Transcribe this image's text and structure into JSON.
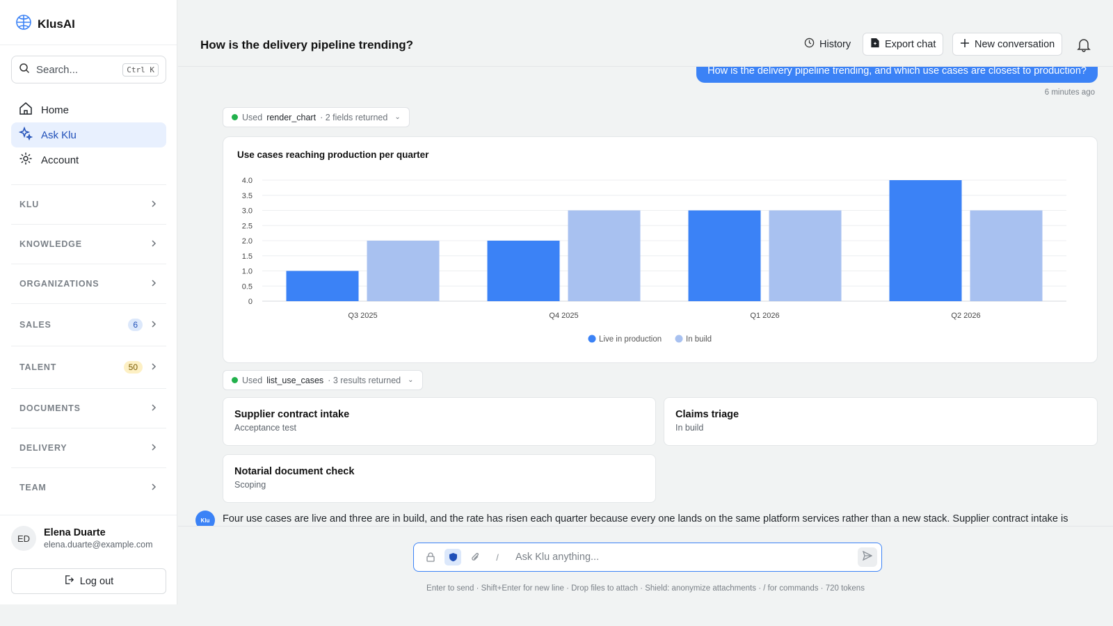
{
  "app": {
    "name": "KlusAI"
  },
  "search": {
    "placeholder": "Search...",
    "shortcut": "Ctrl K"
  },
  "nav": [
    {
      "label": "Home",
      "icon": "home-icon"
    },
    {
      "label": "Ask Klu",
      "icon": "sparkles-icon",
      "active": true
    },
    {
      "label": "Account",
      "icon": "gear-icon"
    }
  ],
  "sections": [
    {
      "label": "KLU"
    },
    {
      "label": "KNOWLEDGE"
    },
    {
      "label": "ORGANIZATIONS"
    },
    {
      "label": "SALES",
      "badge": "6",
      "badge_color": "#dce8fb"
    },
    {
      "label": "TALENT",
      "badge": "50",
      "badge_color": "#fdf0c4"
    },
    {
      "label": "DOCUMENTS"
    },
    {
      "label": "DELIVERY"
    },
    {
      "label": "TEAM"
    }
  ],
  "user": {
    "initials": "ED",
    "name": "Elena Duarte",
    "email": "elena.duarte@example.com"
  },
  "logout_label": "Log out",
  "header": {
    "title": "How is the delivery pipeline trending?",
    "history": "History",
    "export": "Export chat",
    "new_conversation": "New conversation"
  },
  "conversation": {
    "user_message": "How is the delivery pipeline trending, and which use cases are closest to production?",
    "user_time": "6 minutes ago",
    "tool1": {
      "used": "Used",
      "name": "render_chart",
      "meta": "· 2 fields returned"
    },
    "tool2": {
      "used": "Used",
      "name": "list_use_cases",
      "meta": "· 3 results returned"
    },
    "use_cases": [
      {
        "title": "Supplier contract intake",
        "status": "Acceptance test"
      },
      {
        "title": "Claims triage",
        "status": "In build"
      },
      {
        "title": "Notarial document check",
        "status": "Scoping"
      }
    ],
    "assistant_avatar": "Klu",
    "assistant_text": "Four use cases are live and three are in build, and the rate has risen each quarter because every one lands on the same platform services rather than a new stack. Supplier contract intake is"
  },
  "chart_data": {
    "type": "bar",
    "title": "Use cases reaching production per quarter",
    "categories": [
      "Q3 2025",
      "Q4 2025",
      "Q1 2026",
      "Q2 2026"
    ],
    "series": [
      {
        "name": "Live in production",
        "values": [
          1,
          2,
          3,
          4
        ],
        "color": "#3b82f6"
      },
      {
        "name": "In build",
        "values": [
          2,
          3,
          3,
          3
        ],
        "color": "#a8c1f0"
      }
    ],
    "ylim": [
      0,
      4
    ],
    "yticks": [
      "0",
      "0.5",
      "1.0",
      "1.5",
      "2.0",
      "2.5",
      "3.0",
      "3.5",
      "4.0"
    ],
    "ytick_values": [
      0,
      0.5,
      1,
      1.5,
      2,
      2.5,
      3,
      3.5,
      4
    ],
    "grid": true,
    "legend": "bottom-center"
  },
  "composer": {
    "placeholder": "Ask Klu anything...",
    "slash": "/",
    "hint": "Enter to send · Shift+Enter for new line · Drop files to attach · Shield: anonymize attachments · / for commands · 720 tokens"
  },
  "colors": {
    "accent": "#3b82f6",
    "accent_light": "#a8c1f0",
    "active_bg": "#e8f0fe"
  }
}
